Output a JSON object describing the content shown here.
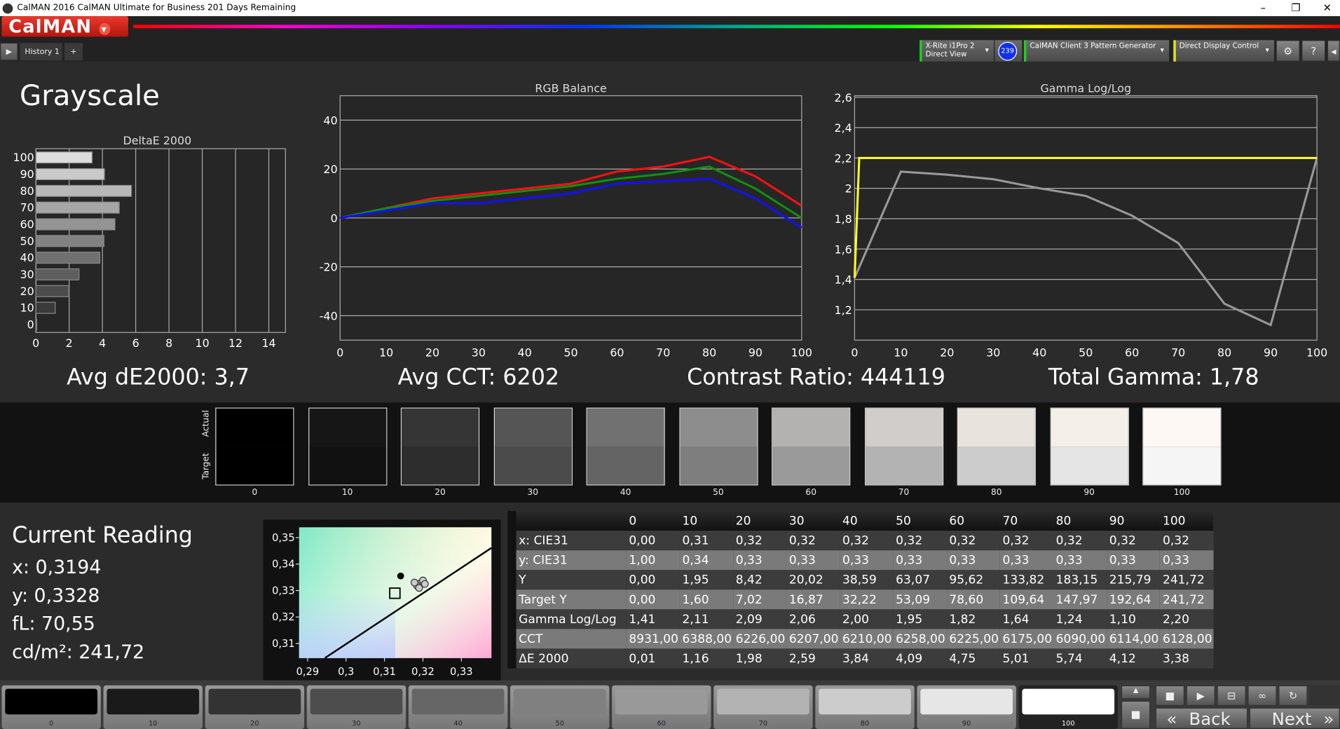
{
  "window": {
    "title": "CalMAN 2016 CalMAN Ultimate for Business 201 Days Remaining",
    "minimize": "–",
    "restore": "❐",
    "close": "✕"
  },
  "app": {
    "logo": "CalMAN",
    "logo_menu": "▾",
    "tab": "History 1",
    "add_tab": "+",
    "play": "▶"
  },
  "devices": [
    {
      "label": "X-Rite i1Pro 2",
      "sub": "Direct View",
      "accent": "#22cc22"
    },
    {
      "badge": "239"
    },
    {
      "label": "CalMAN Client 3 Pattern Generator",
      "accent": "#22cc22"
    },
    {
      "label": "Direct Display Control",
      "accent": "#dddd22"
    }
  ],
  "toolbar_icons": [
    "gear-icon",
    "help-icon",
    "collapse-icon"
  ],
  "page": {
    "title": "Grayscale"
  },
  "stats": {
    "avg_de": "Avg dE2000: 3,7",
    "avg_cct": "Avg CCT: 6202",
    "contrast": "Contrast Ratio: 444119",
    "gamma": "Total Gamma: 1,78"
  },
  "chart_data": [
    {
      "type": "bar",
      "title": "DeltaE 2000",
      "orientation": "horizontal",
      "categories": [
        "0",
        "10",
        "20",
        "30",
        "40",
        "50",
        "60",
        "70",
        "80",
        "90",
        "100"
      ],
      "values": [
        0.01,
        1.16,
        1.98,
        2.59,
        3.84,
        4.09,
        4.75,
        5.01,
        5.74,
        4.12,
        3.38
      ],
      "xlim": [
        0,
        15
      ],
      "xticks": [
        "0",
        "2",
        "4",
        "6",
        "8",
        "10",
        "12",
        "14"
      ],
      "grid": true
    },
    {
      "type": "line",
      "title": "RGB Balance",
      "x": [
        0,
        10,
        20,
        30,
        40,
        50,
        60,
        70,
        80,
        90,
        100
      ],
      "ylim": [
        -50,
        50
      ],
      "yticks": [
        "40",
        "20",
        "0",
        "-20",
        "-40"
      ],
      "xticks": [
        "0",
        "10",
        "20",
        "30",
        "40",
        "50",
        "60",
        "70",
        "80",
        "90",
        "100"
      ],
      "grid": true,
      "series": [
        {
          "color": "#ff1010",
          "values": [
            0,
            4,
            8,
            10,
            12,
            14,
            19,
            21,
            25,
            17,
            5
          ]
        },
        {
          "color": "#109010",
          "values": [
            0,
            4,
            7,
            9,
            11,
            13,
            16,
            18,
            21,
            12,
            0
          ]
        },
        {
          "color": "#1010ff",
          "values": [
            0,
            3,
            6,
            6,
            8,
            10,
            14,
            15,
            16,
            8,
            -4
          ]
        }
      ]
    },
    {
      "type": "line",
      "title": "Gamma Log/Log",
      "x": [
        0,
        10,
        20,
        30,
        40,
        50,
        60,
        70,
        80,
        90,
        100
      ],
      "ylim": [
        1.0,
        2.61
      ],
      "yticks": [
        "2,6",
        "2,4",
        "2,2",
        "2",
        "1,8",
        "1,6",
        "1,4",
        "1,2"
      ],
      "xticks": [
        "0",
        "10",
        "20",
        "30",
        "40",
        "50",
        "60",
        "70",
        "80",
        "90",
        "100"
      ],
      "grid": true,
      "series": [
        {
          "color": "#999999",
          "values": [
            1.41,
            2.11,
            2.09,
            2.06,
            2.0,
            1.95,
            1.82,
            1.64,
            1.24,
            1.1,
            2.2
          ]
        },
        {
          "color": "#ffff22",
          "target": true,
          "x": [
            0,
            1,
            100
          ],
          "values": [
            1.41,
            2.2,
            2.2
          ]
        }
      ]
    },
    {
      "type": "scatter",
      "title": "",
      "xlim": [
        0.2878,
        0.3378
      ],
      "ylim": [
        0.3045,
        0.3539
      ],
      "xticks": [
        "0,29",
        "0,3",
        "0,31",
        "0,32",
        "0,33"
      ],
      "yticks": [
        "0,35",
        "0,34",
        "0,33",
        "0,32",
        "0,31"
      ],
      "target": {
        "x": 0.3127,
        "y": 0.329
      },
      "current": {
        "x": 0.3142,
        "y": 0.3355
      },
      "points": [
        {
          "x": 0.3194,
          "y": 0.3328
        },
        {
          "x": 0.3185,
          "y": 0.3318
        },
        {
          "x": 0.32,
          "y": 0.3338
        },
        {
          "x": 0.3178,
          "y": 0.333
        },
        {
          "x": 0.319,
          "y": 0.331
        },
        {
          "x": 0.3205,
          "y": 0.3325
        }
      ],
      "locus": {
        "x": [
          0.2945,
          0.3378
        ],
        "y": [
          0.3045,
          0.3461
        ]
      }
    }
  ],
  "swatches": {
    "actual_label": "Actual",
    "target_label": "Target",
    "items": [
      {
        "label": "0",
        "actual": "#000000",
        "target": "#000000"
      },
      {
        "label": "10",
        "actual": "#161616",
        "target": "#111111"
      },
      {
        "label": "20",
        "actual": "#353535",
        "target": "#2d2d2d"
      },
      {
        "label": "30",
        "actual": "#555555",
        "target": "#4b4b4b"
      },
      {
        "label": "40",
        "actual": "#717171",
        "target": "#646464"
      },
      {
        "label": "50",
        "actual": "#8d8d8d",
        "target": "#7e7e7e"
      },
      {
        "label": "60",
        "actual": "#b4b2b0",
        "target": "#9a9a9a"
      },
      {
        "label": "70",
        "actual": "#d0cdca",
        "target": "#b3b3b3"
      },
      {
        "label": "80",
        "actual": "#e8e3dd",
        "target": "#cccccc"
      },
      {
        "label": "90",
        "actual": "#f4efe9",
        "target": "#e5e5e5"
      },
      {
        "label": "100",
        "actual": "#fdf8f4",
        "target": "#f5f5f5"
      }
    ]
  },
  "current_reading": {
    "title": "Current Reading",
    "x": "x: 0,3194",
    "y": "y: 0,3328",
    "fl": "fL: 70,55",
    "cdm2": "cd/m²: 241,72"
  },
  "table": {
    "headers": [
      "",
      "0",
      "10",
      "20",
      "30",
      "40",
      "50",
      "60",
      "70",
      "80",
      "90",
      "100"
    ],
    "rows": [
      [
        "x: CIE31",
        "0,00",
        "0,31",
        "0,32",
        "0,32",
        "0,32",
        "0,32",
        "0,32",
        "0,32",
        "0,32",
        "0,32",
        "0,32"
      ],
      [
        "y: CIE31",
        "1,00",
        "0,34",
        "0,33",
        "0,33",
        "0,33",
        "0,33",
        "0,33",
        "0,33",
        "0,33",
        "0,33",
        "0,33"
      ],
      [
        "Y",
        "0,00",
        "1,95",
        "8,42",
        "20,02",
        "38,59",
        "63,07",
        "95,62",
        "133,82",
        "183,15",
        "215,79",
        "241,72"
      ],
      [
        "Target Y",
        "0,00",
        "1,60",
        "7,02",
        "16,87",
        "32,22",
        "53,09",
        "78,60",
        "109,64",
        "147,97",
        "192,64",
        "241,72"
      ],
      [
        "Gamma Log/Log",
        "1,41",
        "2,11",
        "2,09",
        "2,06",
        "2,00",
        "1,95",
        "1,82",
        "1,64",
        "1,24",
        "1,10",
        "2,20"
      ],
      [
        "CCT",
        "8931,00",
        "6388,00",
        "6226,00",
        "6207,00",
        "6210,00",
        "6258,00",
        "6225,00",
        "6175,00",
        "6090,00",
        "6114,00",
        "6128,00"
      ],
      [
        "ΔE 2000",
        "0,01",
        "1,16",
        "1,98",
        "2,59",
        "3,84",
        "4,09",
        "4,75",
        "5,01",
        "5,74",
        "4,12",
        "3,38"
      ]
    ]
  },
  "bottom_patches": [
    {
      "label": "0",
      "color": "#000000"
    },
    {
      "label": "10",
      "color": "#1a1a1a"
    },
    {
      "label": "20",
      "color": "#333333"
    },
    {
      "label": "30",
      "color": "#4d4d4d"
    },
    {
      "label": "40",
      "color": "#666666"
    },
    {
      "label": "50",
      "color": "#808080"
    },
    {
      "label": "60",
      "color": "#999999"
    },
    {
      "label": "70",
      "color": "#b3b3b3"
    },
    {
      "label": "80",
      "color": "#cccccc"
    },
    {
      "label": "90",
      "color": "#e6e6e6"
    },
    {
      "label": "100",
      "color": "#ffffff",
      "selected": true
    }
  ],
  "nav": {
    "back": "Back",
    "next": "Next",
    "back_icon": "«",
    "next_icon": "»"
  }
}
